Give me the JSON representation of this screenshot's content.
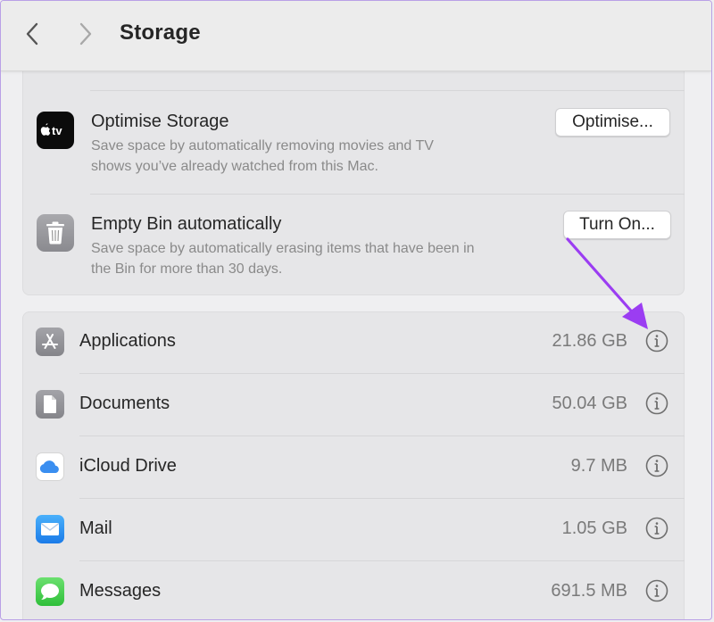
{
  "toolbar": {
    "title": "Storage",
    "back_icon": "chevron-left-icon",
    "forward_icon": "chevron-right-icon"
  },
  "recommendations": [
    {
      "icon": "apple-tv-icon",
      "icon_text": "tv",
      "title": "Optimise Storage",
      "description_line1": "Save space by automatically removing movies and TV",
      "description_line2": "shows you’ve already watched from this Mac.",
      "button_label": "Optimise..."
    },
    {
      "icon": "trash-bin-icon",
      "title": "Empty Bin automatically",
      "description_line1": "Save space by automatically erasing items that have been in",
      "description_line2": "the Bin for more than 30 days.",
      "button_label": "Turn On..."
    }
  ],
  "storage_items": [
    {
      "label": "Applications",
      "size": "21.86 GB",
      "icon": "app-store-icon"
    },
    {
      "label": "Documents",
      "size": "50.04 GB",
      "icon": "document-icon"
    },
    {
      "label": "iCloud Drive",
      "size": "9.7 MB",
      "icon": "icloud-icon"
    },
    {
      "label": "Mail",
      "size": "1.05 GB",
      "icon": "mail-icon"
    },
    {
      "label": "Messages",
      "size": "691.5 MB",
      "icon": "messages-icon"
    }
  ],
  "colors": {
    "annotation_arrow": "#9b3df2",
    "icloud_blue": "#3a8ef0",
    "mail_blue": "#2b8ef0",
    "messages_green": "#3ccb4b"
  }
}
